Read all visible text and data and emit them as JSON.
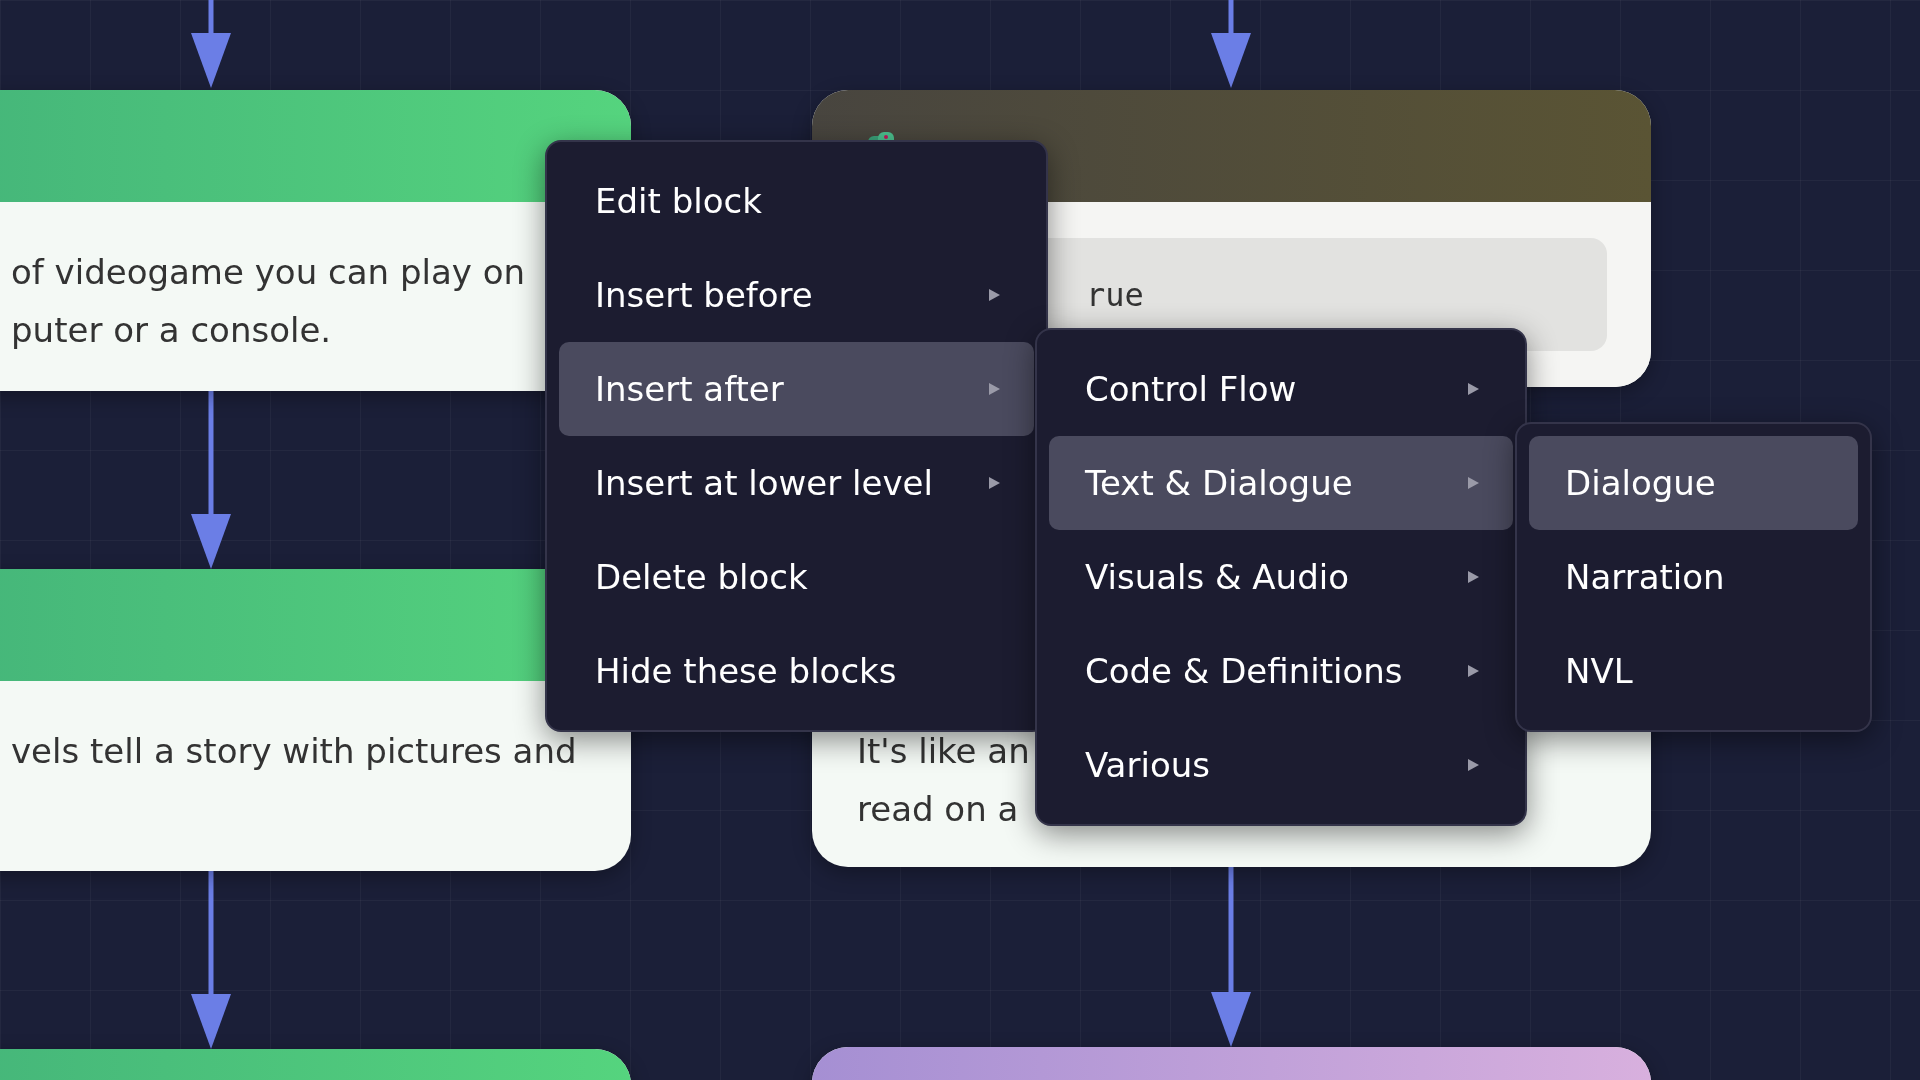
{
  "cards": [
    {
      "kind": "green",
      "lines": [
        "of videogame you can play on",
        "puter or a console."
      ]
    },
    {
      "kind": "python",
      "code": "rue"
    },
    {
      "kind": "green",
      "lines": [
        "vels tell a story with pictures and"
      ]
    },
    {
      "kind": "plain",
      "lines": [
        "It's like an",
        "read on a"
      ]
    },
    {
      "kind": "green"
    },
    {
      "kind": "purple"
    }
  ],
  "menus": [
    {
      "items": [
        {
          "label": "Edit block",
          "submenu": false,
          "selected": false
        },
        {
          "label": "Insert before",
          "submenu": true,
          "selected": false
        },
        {
          "label": "Insert after",
          "submenu": true,
          "selected": true
        },
        {
          "label": "Insert at lower level",
          "submenu": true,
          "selected": false
        },
        {
          "label": "Delete block",
          "submenu": false,
          "selected": false
        },
        {
          "label": "Hide these blocks",
          "submenu": false,
          "selected": false
        }
      ]
    },
    {
      "items": [
        {
          "label": "Control Flow",
          "submenu": true,
          "selected": false
        },
        {
          "label": "Text & Dialogue",
          "submenu": true,
          "selected": true
        },
        {
          "label": "Visuals & Audio",
          "submenu": true,
          "selected": false
        },
        {
          "label": "Code & Definitions",
          "submenu": true,
          "selected": false
        },
        {
          "label": "Various",
          "submenu": true,
          "selected": false
        }
      ]
    },
    {
      "items": [
        {
          "label": "Dialogue",
          "submenu": false,
          "selected": true
        },
        {
          "label": "Narration",
          "submenu": false,
          "selected": false
        },
        {
          "label": "NVL",
          "submenu": false,
          "selected": false
        }
      ]
    }
  ]
}
